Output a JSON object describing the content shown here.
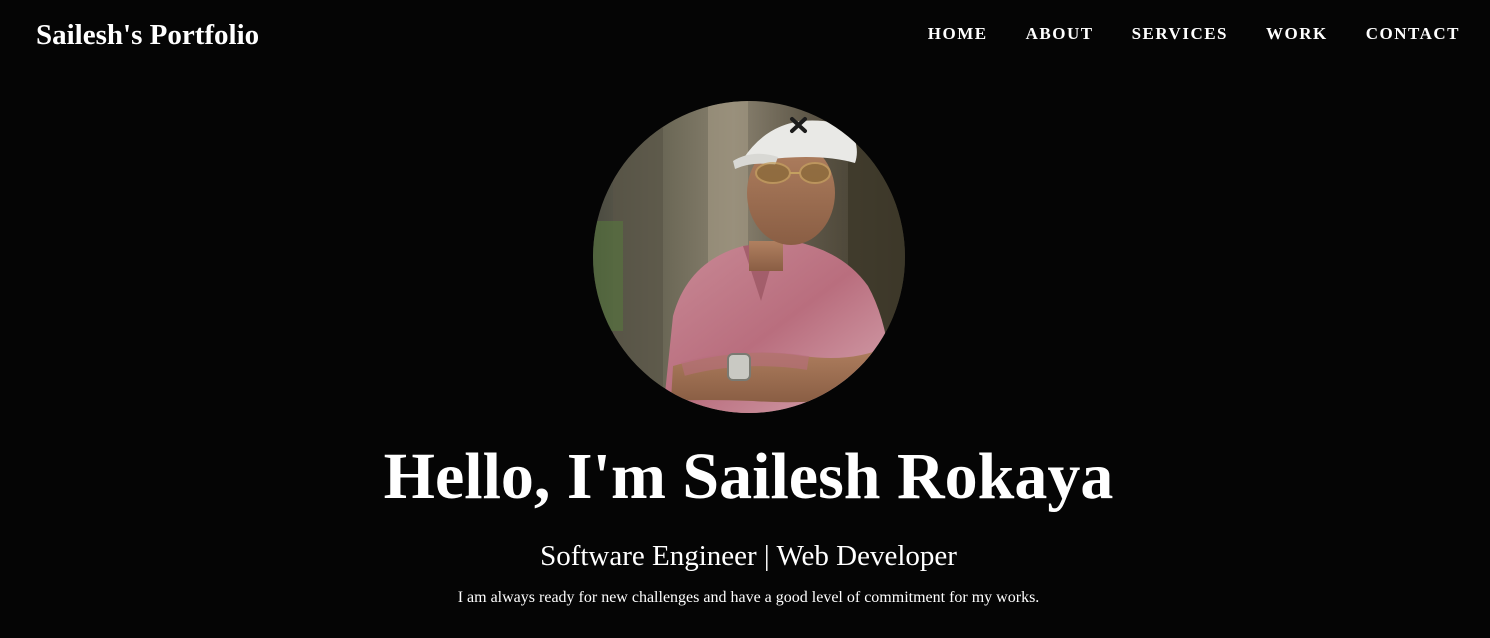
{
  "navbar": {
    "brand": "Sailesh's Portfolio",
    "links": [
      {
        "label": "HOME"
      },
      {
        "label": "ABOUT"
      },
      {
        "label": "SERVICES"
      },
      {
        "label": "WORK"
      },
      {
        "label": "CONTACT"
      }
    ]
  },
  "hero": {
    "avatar_icon": "profile-photo",
    "title": "Hello, I'm Sailesh Rokaya",
    "subtitle": "Software Engineer | Web Developer",
    "tagline": "I am always ready for new challenges and have a good level of commitment for my works."
  },
  "colors": {
    "background": "#050505",
    "text": "#ffffff"
  }
}
